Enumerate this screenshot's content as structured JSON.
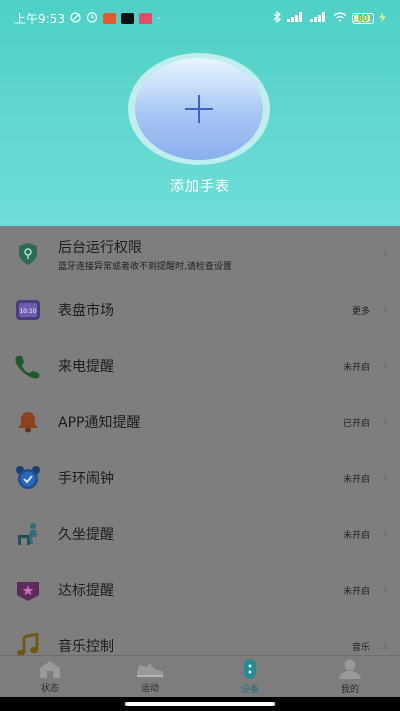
{
  "status_bar": {
    "time": "上午9:53",
    "battery": "80"
  },
  "add_watch": {
    "label": "添加手表"
  },
  "menu": [
    {
      "icon": "shield-icon",
      "title": "后台运行权限",
      "subtitle": "蓝牙连接异常或者收不到提醒时,请检查设置",
      "value": ""
    },
    {
      "icon": "watch-face-icon",
      "title": "表盘市场",
      "subtitle": "",
      "value": "更多"
    },
    {
      "icon": "phone-icon",
      "title": "来电提醒",
      "subtitle": "",
      "value": "未开启"
    },
    {
      "icon": "bell-icon",
      "title": "APP通知提醒",
      "subtitle": "",
      "value": "已开启"
    },
    {
      "icon": "alarm-clock-icon",
      "title": "手环闹钟",
      "subtitle": "",
      "value": "未开启"
    },
    {
      "icon": "sedentary-icon",
      "title": "久坐提醒",
      "subtitle": "",
      "value": "未开启"
    },
    {
      "icon": "goal-badge-icon",
      "title": "达标提醒",
      "subtitle": "",
      "value": "未开启"
    },
    {
      "icon": "music-note-icon",
      "title": "音乐控制",
      "subtitle": "",
      "value": "音乐"
    }
  ],
  "tabs": [
    {
      "icon": "home-icon",
      "label": "状态",
      "active": false
    },
    {
      "icon": "sneaker-icon",
      "label": "运动",
      "active": false
    },
    {
      "icon": "band-icon",
      "label": "设备",
      "active": true
    },
    {
      "icon": "profile-icon",
      "label": "我的",
      "active": false
    }
  ]
}
